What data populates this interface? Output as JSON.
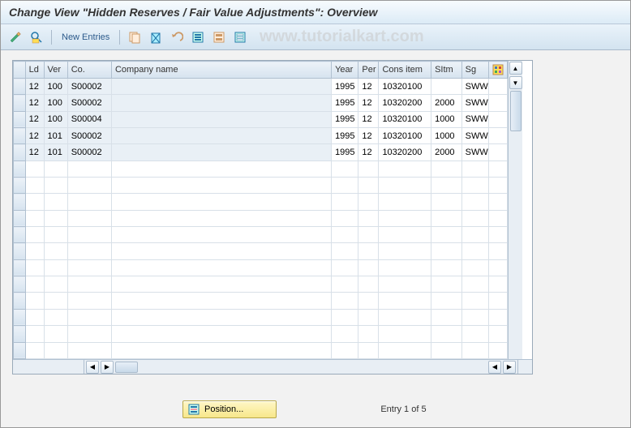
{
  "title": "Change View \"Hidden Reserves / Fair Value Adjustments\": Overview",
  "watermark": "www.tutorialkart.com",
  "toolbar": {
    "new_entries": "New Entries"
  },
  "columns": {
    "ld": "Ld",
    "ver": "Ver",
    "co": "Co.",
    "company_name": "Company name",
    "year": "Year",
    "per": "Per",
    "cons_item": "Cons item",
    "sitm": "SItm",
    "sg": "Sg"
  },
  "rows": [
    {
      "ld": "12",
      "ver": "100",
      "co": "S00002",
      "company_name": "",
      "year": "1995",
      "per": "12",
      "cons_item": "10320100",
      "sitm": "",
      "sg": "SWW"
    },
    {
      "ld": "12",
      "ver": "100",
      "co": "S00002",
      "company_name": "",
      "year": "1995",
      "per": "12",
      "cons_item": "10320200",
      "sitm": "2000",
      "sg": "SWW"
    },
    {
      "ld": "12",
      "ver": "100",
      "co": "S00004",
      "company_name": "",
      "year": "1995",
      "per": "12",
      "cons_item": "10320100",
      "sitm": "1000",
      "sg": "SWW"
    },
    {
      "ld": "12",
      "ver": "101",
      "co": "S00002",
      "company_name": "",
      "year": "1995",
      "per": "12",
      "cons_item": "10320100",
      "sitm": "1000",
      "sg": "SWW"
    },
    {
      "ld": "12",
      "ver": "101",
      "co": "S00002",
      "company_name": "",
      "year": "1995",
      "per": "12",
      "cons_item": "10320200",
      "sitm": "2000",
      "sg": "SWW"
    }
  ],
  "empty_rows": 12,
  "position_button": "Position...",
  "entry_status": "Entry 1 of 5"
}
